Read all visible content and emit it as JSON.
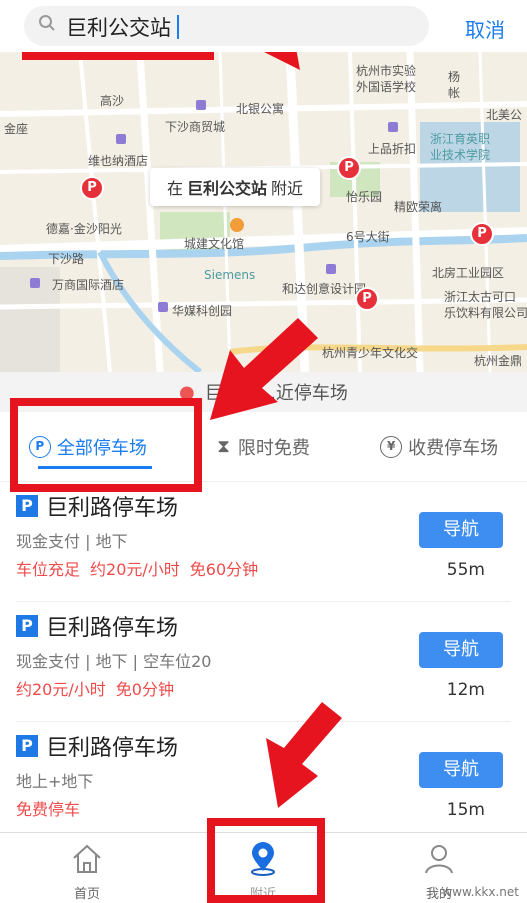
{
  "search": {
    "query": "巨利公交站",
    "cancel": "取消"
  },
  "map": {
    "near_prefix": "在",
    "near_place": "巨利公交站",
    "near_suffix": "附近",
    "labels": [
      "北银公寓",
      "下沙商贸城",
      "维也纳酒店",
      "德嘉·金沙阳光",
      "万商国际酒店",
      "城建文化馆",
      "Siemens",
      "华媒科创园",
      "和达创意设计园",
      "杭州青少年文化交",
      "杭州市实验",
      "外国语学校",
      "上品折扣",
      "怡乐园",
      "精欧荣离",
      "浙江育英职",
      "业技术学院",
      "北美公",
      "北房工业园区",
      "浙江太古可口",
      "乐饮料有限公司",
      "6号大街",
      "下沙路",
      "高沙",
      "杭州金鼎",
      "金座",
      "杨",
      "帐"
    ]
  },
  "location_strip": {
    "text": "巨利新...近停车场"
  },
  "tabs": [
    {
      "label": "全部停车场",
      "icon": "P",
      "active": true
    },
    {
      "label": "限时免费",
      "icon": "hourglass-icon",
      "active": false
    },
    {
      "label": "收费停车场",
      "icon": "¥",
      "active": false
    }
  ],
  "parking": [
    {
      "name": "巨利路停车场",
      "info": "现金支付 | 地下",
      "tags": [
        "车位充足",
        "约20元/小时",
        "免60分钟"
      ],
      "nav": "导航",
      "distance": "55m"
    },
    {
      "name": "巨利路停车场",
      "info": "现金支付 | 地下 | 空车位20",
      "tags": [
        "约20元/小时",
        "免0分钟"
      ],
      "nav": "导航",
      "distance": "12m"
    },
    {
      "name": "巨利路停车场",
      "info": "地上+地下",
      "tags": [
        "免费停车"
      ],
      "nav": "导航",
      "distance": "15m"
    }
  ],
  "bottom_nav": [
    {
      "label": "首页",
      "icon": "home-icon"
    },
    {
      "label": "附近",
      "icon": "location-pin-icon"
    },
    {
      "label": "我的",
      "icon": "user-icon"
    }
  ],
  "watermark": "www.kkx.net",
  "colors": {
    "accent": "#1a7cf0",
    "annotation": "#e5141f",
    "tag_red": "#ef4b4b"
  }
}
